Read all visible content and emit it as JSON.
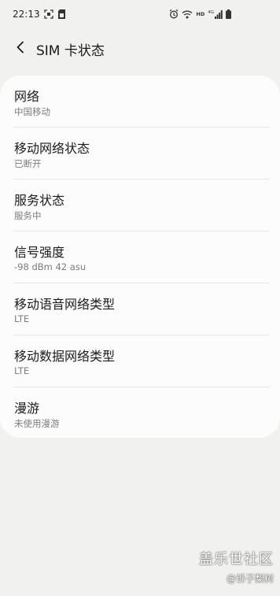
{
  "status_bar": {
    "time": "22:13",
    "left_icons": [
      "screenshot-icon",
      "sim-storage-icon"
    ],
    "right_icons": [
      "alarm-icon",
      "wifi-icon",
      "hd-icon",
      "signal-4g-icon",
      "battery-icon"
    ],
    "hd_label": "HD",
    "network_label": "4G"
  },
  "header": {
    "back_icon": "back-arrow-icon",
    "title": "SIM 卡状态"
  },
  "rows": [
    {
      "title": "网络",
      "subtitle": "中国移动"
    },
    {
      "title": "移动网络状态",
      "subtitle": "已断开"
    },
    {
      "title": "服务状态",
      "subtitle": "服务中"
    },
    {
      "title": "信号强度",
      "subtitle": "-98 dBm 42 asu"
    },
    {
      "title": "移动语音网络类型",
      "subtitle": "LTE"
    },
    {
      "title": "移动数据网络类型",
      "subtitle": "LTE"
    },
    {
      "title": "漫游",
      "subtitle": "未使用漫游"
    }
  ],
  "watermark": {
    "line1": "盖乐世社区",
    "line2": "@诉子梨树"
  }
}
